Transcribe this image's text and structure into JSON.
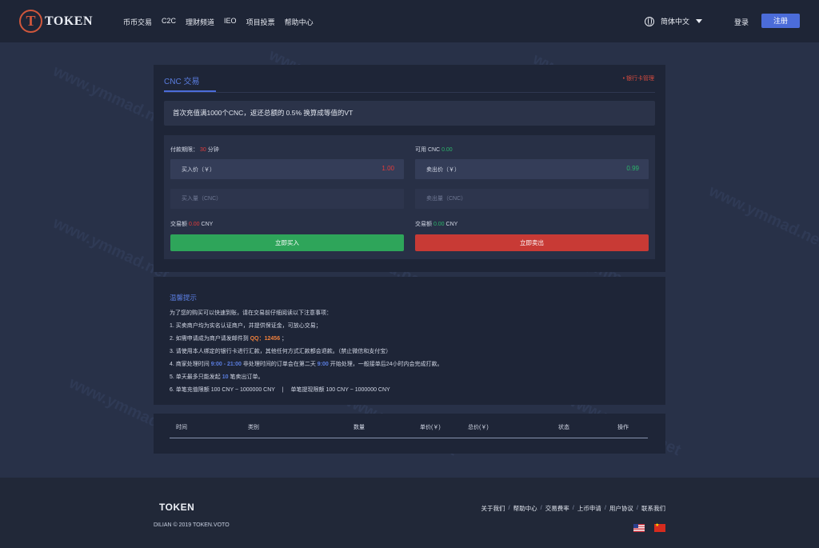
{
  "header": {
    "logo_text": "TOKEN",
    "nav": [
      "币币交易",
      "C2C",
      "理财频道",
      "IEO",
      "项目投票",
      "帮助中心"
    ],
    "language": "简体中文",
    "login": "登录",
    "register": "注册"
  },
  "panel": {
    "tab": "CNC 交易",
    "bank_link": "• 银行卡管理",
    "notice": "首次充值满1000个CNC，返还总额的 0.5% 换算成等值的VT"
  },
  "buy": {
    "deadline_label": "付款期限：",
    "deadline_value": "30",
    "deadline_unit": "分钟",
    "price_label": "买入价（￥）",
    "price_value": "1.00",
    "qty_placeholder": "买入量（CNC）",
    "amount_label": "交易额",
    "amount_value": "0.00",
    "amount_unit": "CNY",
    "button": "立即买入"
  },
  "sell": {
    "available_label": "可用 CNC",
    "available_value": "0.00",
    "price_label": "卖出价（￥）",
    "price_value": "0.99",
    "qty_placeholder": "卖出量（CNC）",
    "amount_label": "交易额",
    "amount_value": "0.00",
    "amount_unit": "CNY",
    "button": "立即卖出"
  },
  "tips": {
    "title": "温馨提示",
    "intro": "为了您的购买可以快速到账，请在交易前仔细阅读以下注意事项：",
    "item1": "1. 买卖商户均为实名认证商户，并提供保证金，可放心交易；",
    "item2_pre": "2. 如需申请成为商户请发邮件到 ",
    "item2_qq": "QQ：12456",
    "item2_post": " ；",
    "item3": "3. 请使用本人绑定的银行卡进行汇款，其他任何方式汇款都会退款。（禁止微信和支付宝）",
    "item4_pre": "4. 商家处理时间 ",
    "item4_time": "9:00 - 21:00",
    "item4_mid": " 非处理时间的订单会在第二天 ",
    "item4_time2": "9:00",
    "item4_post": " 开始处理，一般接单后24小时内会完成打款。",
    "item5_pre": "5. 单天最多只能发起 ",
    "item5_num": "10",
    "item5_post": " 笔卖出订单。",
    "item6": "6. 单笔充值限额 100 CNY ~ 1000000 CNY　 |　 单笔提现限额 100 CNY ~ 1000000 CNY"
  },
  "orders": {
    "columns": [
      "时间",
      "类别",
      "数量",
      "单价(￥)",
      "总价(￥)",
      "状态",
      "操作"
    ]
  },
  "footer": {
    "logo": "TOKEN",
    "copyright": "DILIAN © 2019 TOKEN.VOTO",
    "links": [
      "关于我们",
      "帮助中心",
      "交易费率",
      "上币申请",
      "用户协议",
      "联系我们"
    ],
    "flags": [
      "us-flag-icon",
      "cn-flag-icon"
    ]
  },
  "watermark": "www.ymmad.net",
  "colors": {
    "accent": "#4b6cd9",
    "buy": "#2ea55a",
    "sell": "#c83a35",
    "highlight": "#f0803c"
  }
}
